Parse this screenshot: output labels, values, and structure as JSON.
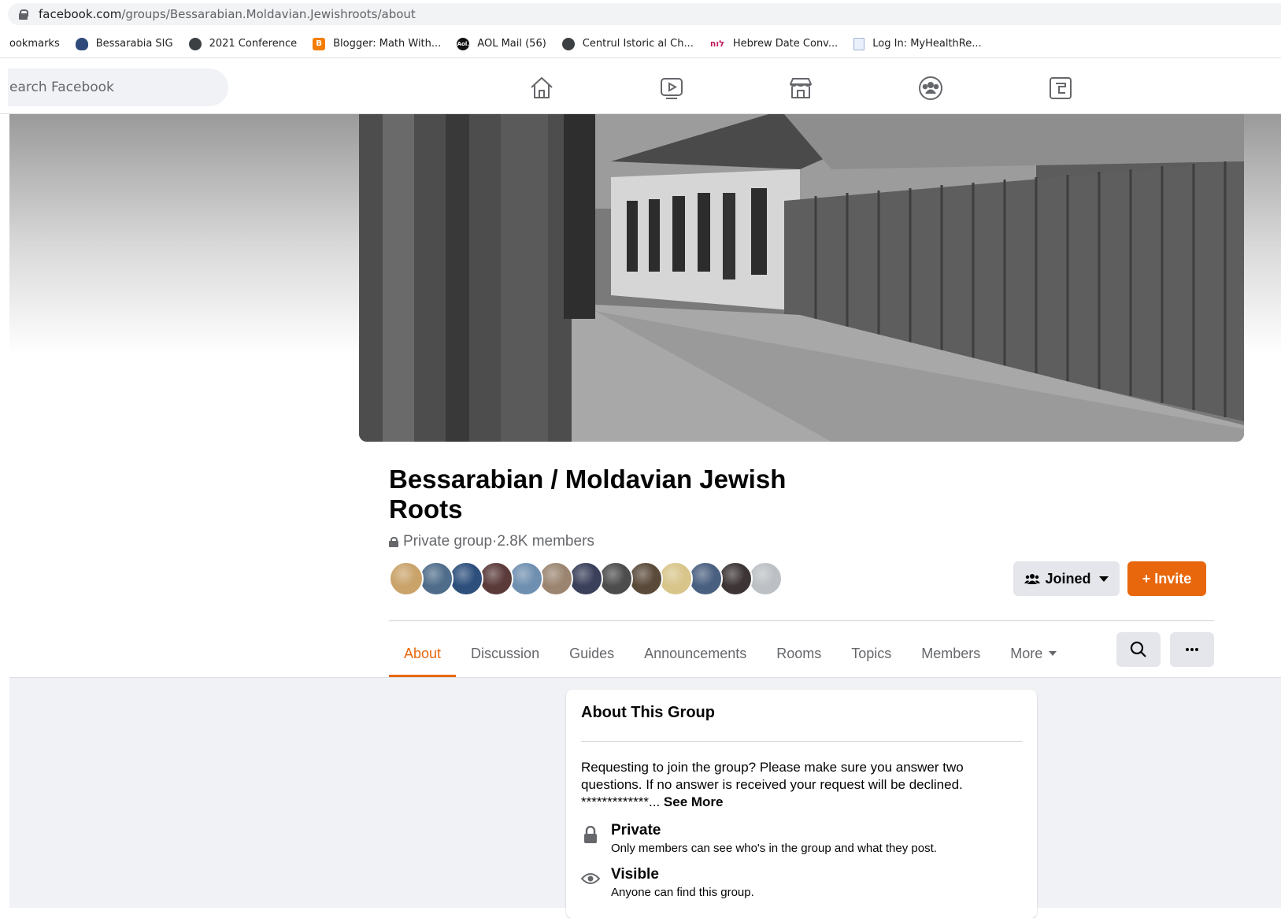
{
  "browser": {
    "url_host": "facebook.com",
    "url_path": "/groups/Bessarabian.Moldavian.Jewishroots/about"
  },
  "bookmarks": [
    {
      "label": "ookmarks",
      "icon": "none"
    },
    {
      "label": "Bessarabia SIG",
      "icon": "sig-crest-icon"
    },
    {
      "label": "2021 Conference",
      "icon": "globe-icon"
    },
    {
      "label": "Blogger: Math With...",
      "icon": "blogger-icon"
    },
    {
      "label": "AOL Mail (56)",
      "icon": "aol-icon"
    },
    {
      "label": "Centrul Istoric al Ch...",
      "icon": "globe-icon"
    },
    {
      "label": "Hebrew Date Conv...",
      "icon": "hebrew-calendar-icon"
    },
    {
      "label": "Log In: MyHealthRe...",
      "icon": "document-icon"
    }
  ],
  "bookmark_icon_text": {
    "blogger": "B",
    "aol": "Aol.",
    "hebrew": "לוח"
  },
  "fb_nav": {
    "search_placeholder": "earch Facebook",
    "icons": [
      "home-icon",
      "watch-icon",
      "marketplace-icon",
      "groups-icon",
      "gaming-icon"
    ]
  },
  "group": {
    "title": "Bessarabian / Moldavian Jewish Roots",
    "privacy": "Private group",
    "separator": " · ",
    "members": "2.8K members",
    "avatar_colors": [
      "#c9a36a",
      "#4f6d8a",
      "#2d4f7c",
      "#5b3a3a",
      "#6f8fb0",
      "#9b8570",
      "#3a3f5a",
      "#4d4d4d",
      "#5a4a3a",
      "#d8c58a",
      "#4a6080",
      "#3d3535",
      "#bcc0c4"
    ],
    "joined_label": "Joined",
    "invite_label": "+ Invite"
  },
  "tabs": [
    {
      "label": "About",
      "active": true
    },
    {
      "label": "Discussion",
      "active": false
    },
    {
      "label": "Guides",
      "active": false
    },
    {
      "label": "Announcements",
      "active": false
    },
    {
      "label": "Rooms",
      "active": false
    },
    {
      "label": "Topics",
      "active": false
    },
    {
      "label": "Members",
      "active": false
    },
    {
      "label": "More",
      "active": false
    }
  ],
  "about": {
    "title": "About This Group",
    "description": "Requesting to join the group? Please make sure you answer two questions. If no answer is received your request will be declined. *************... ",
    "see_more": "See More",
    "private_title": "Private",
    "private_sub": "Only members can see who's in the group and what they post.",
    "visible_title": "Visible",
    "visible_sub": "Anyone can find this group."
  },
  "colors": {
    "accent": "#e8670c",
    "grey_text": "#65676b",
    "button_grey": "#e4e6eb",
    "body_bg": "#f0f2f5"
  }
}
